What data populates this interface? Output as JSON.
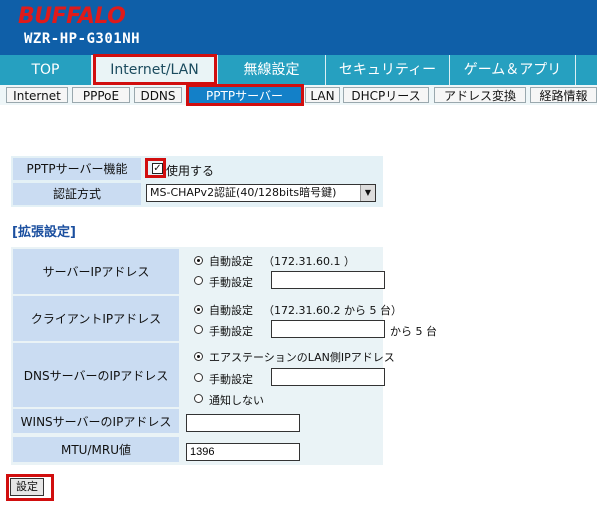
{
  "brand": {
    "logo": "BUFFALO",
    "model": "WZR-HP-G301NH",
    "logo_color": "#e01a1a"
  },
  "main_tabs": [
    "TOP",
    "Internet/LAN",
    "無線設定",
    "セキュリティー",
    "ゲーム＆アプリ"
  ],
  "main_tab_selected": "Internet/LAN",
  "sub_tabs": [
    "Internet",
    "PPPoE",
    "DDNS",
    "PPTPサーバー",
    "LAN",
    "DHCPリース",
    "アドレス変換",
    "経路情報"
  ],
  "sub_tab_selected": "PPTPサーバー",
  "basic": {
    "pptp_label": "PPTPサーバー機能",
    "pptp_checkbox_label": "使用する",
    "pptp_checked": true,
    "auth_label": "認証方式",
    "auth_value": "MS-CHAPv2認証(40/128bits暗号鍵)"
  },
  "extended": {
    "title": "[拡張設定]",
    "server_ip": {
      "label": "サーバーIPアドレス",
      "auto_label": "自動設定",
      "auto_note": "（172.31.60.1 ）",
      "manual_label": "手動設定",
      "manual_value": "",
      "selected": "auto"
    },
    "client_ip": {
      "label": "クライアントIPアドレス",
      "auto_label": "自動設定",
      "auto_note": "（172.31.60.2 から 5 台）",
      "manual_label": "手動設定",
      "manual_value": "",
      "suffix": "から 5 台",
      "selected": "auto"
    },
    "dns": {
      "label": "DNSサーバーのIPアドレス",
      "opt1": "エアステーションのLAN側IPアドレス",
      "opt2": "手動設定",
      "opt3": "通知しない",
      "manual_value": "",
      "selected": "opt1"
    },
    "wins": {
      "label": "WINSサーバーのIPアドレス",
      "value": ""
    },
    "mtu": {
      "label": "MTU/MRU値",
      "value": "1396"
    }
  },
  "submit_label": "設定",
  "highlight_color": "#d10e0e"
}
